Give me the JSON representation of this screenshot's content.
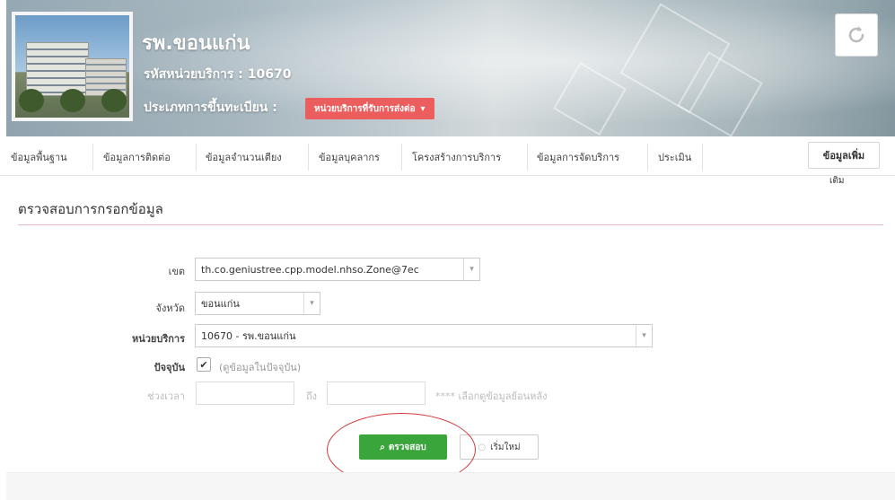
{
  "header": {
    "hospital_name": "รพ.ขอนแก่น",
    "hospital_code": "รหัสหน่วยบริการ : 10670",
    "registration_type_label": "ประเภทการขึ้นทะเบียน :",
    "registration_type_value": "หน่วยบริการที่รับการส่งต่อ",
    "refresh_icon": "refresh-icon"
  },
  "tabs": [
    {
      "label": "ข้อมูลพื้นฐาน"
    },
    {
      "label": "ข้อมูลการติดต่อ"
    },
    {
      "label": "ข้อมูลจำนวนเตียง"
    },
    {
      "label": "ข้อมูลบุคลากร"
    },
    {
      "label": "โครงสร้างการบริการ"
    },
    {
      "label": "ข้อมูลการจัดบริการ"
    },
    {
      "label": "ประเมิน"
    }
  ],
  "more": {
    "label": "ข้อมูลเพิ่ม",
    "label_extra": "เติม"
  },
  "section": {
    "title": "ตรวจสอบการกรอกข้อมูล"
  },
  "form": {
    "zone": {
      "label": "เขต",
      "value": "th.co.geniustree.cpp.model.nhso.Zone@7ec"
    },
    "province": {
      "label": "จังหวัด",
      "value": "ขอนแก่น"
    },
    "unit": {
      "label": "หน่วยบริการ",
      "value": "10670 - รพ.ขอนแก่น"
    },
    "current": {
      "label": "ปัจจุบัน",
      "checked": true,
      "hint": "(ดูข้อมูลในปัจจุบัน)"
    },
    "period": {
      "label": "ช่วงเวลา",
      "to_label": "ถึง",
      "from_value": "",
      "to_value": "",
      "hint": "**** เลือกดูข้อมูลย้อนหลัง"
    }
  },
  "actions": {
    "check_label": "ตรวจสอบ",
    "reset_label": "เริ่มใหม่"
  },
  "colors": {
    "accent_red": "#ec5d5d",
    "check_green": "#3aa53a",
    "annotation_red": "#d43b3b"
  }
}
